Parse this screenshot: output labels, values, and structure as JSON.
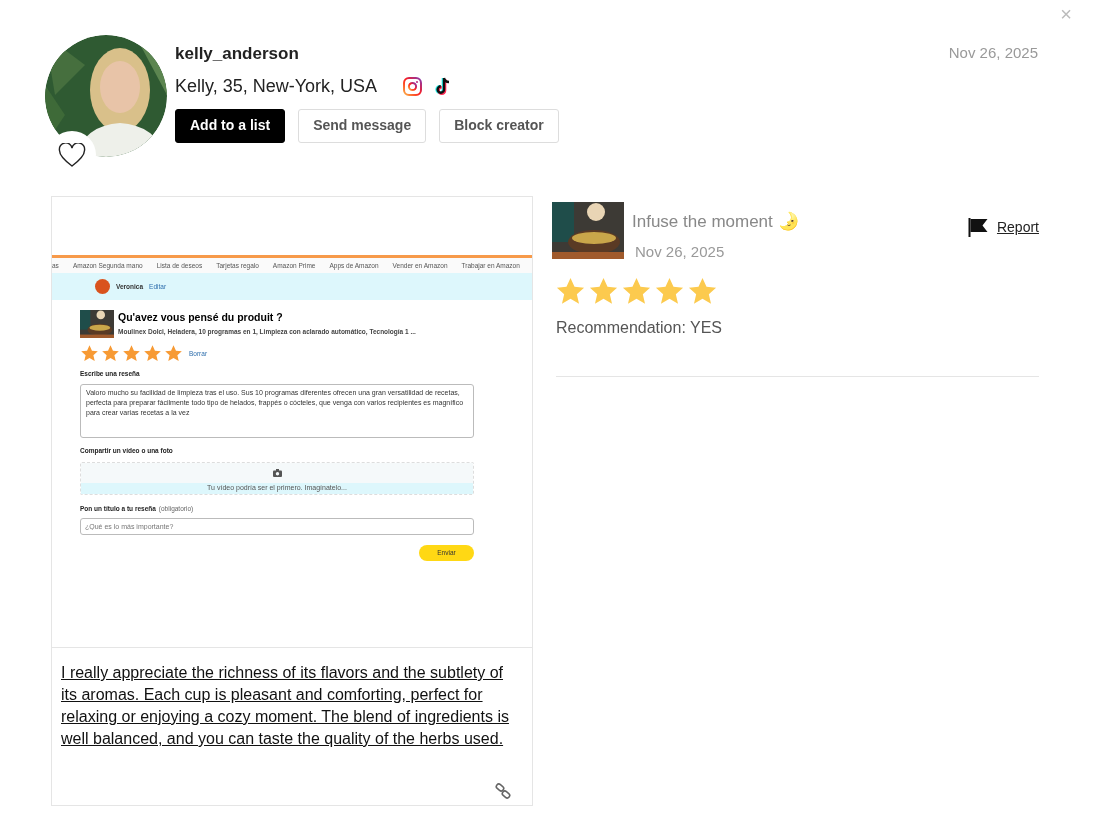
{
  "close_label": "×",
  "profile": {
    "username": "kelly_anderson",
    "details": "Kelly, 35, New-York, USA",
    "favorited": false,
    "date": "Nov 26, 2025",
    "buttons": [
      {
        "label": "Add to a list",
        "kind": "primary"
      },
      {
        "label": "Send message",
        "kind": "secondary"
      },
      {
        "label": "Block creator",
        "kind": "secondary"
      }
    ]
  },
  "post": {
    "screenshot": {
      "nav_items": [
        "as",
        "Amazon Segunda mano",
        "Lista de deseos",
        "Tarjetas regalo",
        "Amazon Prime",
        "Apps de Amazon",
        "Vender en Amazon",
        "Trabajar en Amazon"
      ],
      "user_name": "Veronica",
      "edit_link": "Editar",
      "heading": "Qu'avez vous pensé du produit ?",
      "product": "Moulinex Dolci, Heladera, 10 programas en 1, Limpieza con aclarado automático, Tecnología 1 ...",
      "stars": 5,
      "delete_link": "Borrar",
      "review_label": "Escribe una reseña",
      "review_text": "Valoro mucho su facilidad de limpieza tras el uso. Sus 10 programas diferentes ofrecen una gran versatilidad de recetas, perfecta para preparar fácilmente todo tipo de helados, frappés o cócteles, que venga con varios recipientes es magnífico para crear varias recetas a la vez",
      "share_label": "Compartir un vídeo o una foto",
      "upload_hint": "Tu vídeo podría ser el primero. Imagínatelo...",
      "title_label": "Pon un título a tu reseña",
      "title_note": "(obligatorio)",
      "title_placeholder": "¿Qué es lo más importante?",
      "submit": "Enviar"
    },
    "comment": "I really appreciate the richness of its flavors and the subtlety of its aromas. Each cup is pleasant and comforting, perfect for relaxing or enjoying a cozy moment. The blend of ingredients is well balanced, and you can taste the quality of the herbs used."
  },
  "review": {
    "product_title": "Infuse the moment 🌛",
    "date": "Nov 26, 2025",
    "report": "Report",
    "stars": 5,
    "recommendation": "Recommendation: YES"
  }
}
